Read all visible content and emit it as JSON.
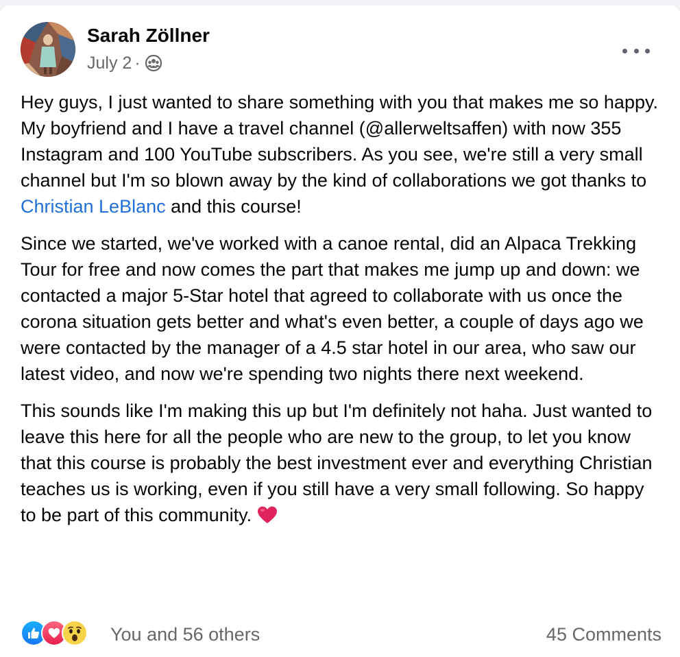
{
  "post": {
    "author": "Sarah Zöllner",
    "date": "July 2",
    "separator": "·",
    "privacy_icon": "group-icon",
    "more_icon": "more-options-icon",
    "paragraphs": [
      {
        "before": "Hey guys, I just wanted to share something with you that makes me so happy. My boyfriend and I have a travel channel (@allerweltsaffen) with now 355 Instagram and 100 YouTube subscribers. As you see, we're still a very small channel but I'm so blown away by the kind of collaborations we got thanks to ",
        "mention": "Christian LeBlanc",
        "after": " and this course!"
      },
      {
        "text": "Since we started, we've worked with a canoe rental, did an Alpaca Trekking Tour for free and now comes the part that makes me jump up and down: we contacted a major 5-Star hotel that agreed to collaborate with us once the corona situation gets better and what's even better, a couple of days ago we were contacted by the manager of a 4.5 star hotel in our area, who saw our latest video, and now we're spending two nights there next weekend."
      },
      {
        "text": "This sounds like I'm making this up but I'm definitely not haha. Just wanted to leave this here for all the people who are new to the group, to let you know that this course is probably the best investment ever and everything Christian teaches us is working, even if you still have a very small following. So happy to be part of this community. ",
        "emoji": "red-heart-icon"
      }
    ],
    "reactions": {
      "icons": [
        "like-icon",
        "love-icon",
        "wow-icon"
      ],
      "summary": "You and 56 others"
    },
    "comments": "45 Comments"
  },
  "colors": {
    "link": "#216fdb",
    "secondary_text": "#65676b",
    "like": "#1877f2",
    "love": "#e61e4d",
    "heart": "#e0245e"
  }
}
